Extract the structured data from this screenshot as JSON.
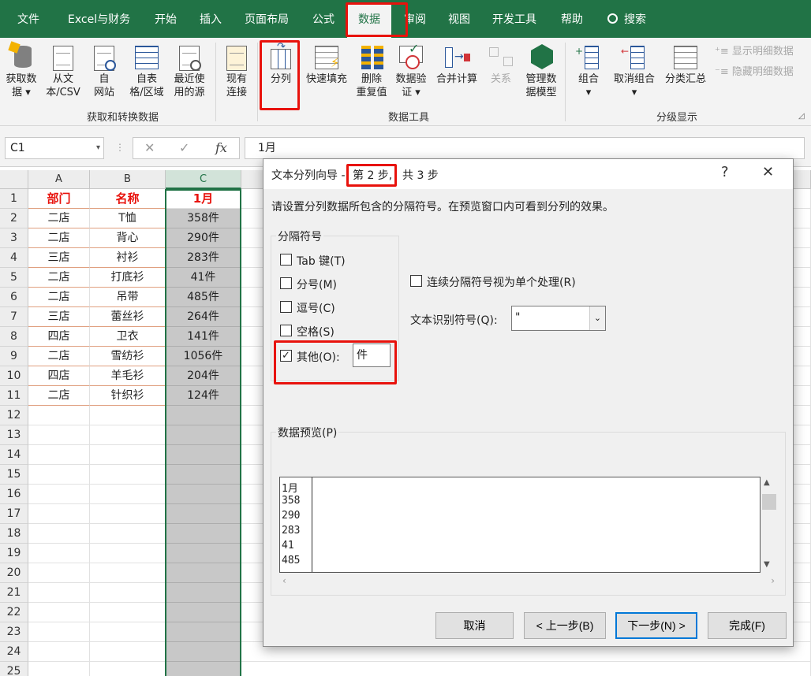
{
  "menu": [
    "文件",
    "Excel与财务",
    "开始",
    "插入",
    "页面布局",
    "公式",
    "数据",
    "审阅",
    "视图",
    "开发工具",
    "帮助"
  ],
  "search_label": "搜索",
  "ribbon": {
    "get_data": [
      "获取数",
      "据"
    ],
    "from_text": [
      "从文",
      "本/CSV"
    ],
    "from_web": [
      "自",
      "网站"
    ],
    "from_table": [
      "自表",
      "格/区域"
    ],
    "recent": [
      "最近使",
      "用的源"
    ],
    "existing": [
      "现有",
      "连接"
    ],
    "split": "分列",
    "flash_fill": "快速填充",
    "remove_dup": [
      "删除",
      "重复值"
    ],
    "validate": [
      "数据验",
      "证"
    ],
    "consolidate": "合并计算",
    "relations": "关系",
    "data_model": [
      "管理数",
      "据模型"
    ],
    "group": "组合",
    "ungroup": "取消组合",
    "subtotal": "分类汇总",
    "show_detail": "显示明细数据",
    "hide_detail": "隐藏明细数据",
    "group_get": "获取和转换数据",
    "group_tools": "数据工具",
    "group_outline": "分级显示"
  },
  "formula": {
    "name_box": "C1",
    "content": "1月"
  },
  "columns": [
    "A",
    "B",
    "C"
  ],
  "rows": [
    [
      "部门",
      "名称",
      "1月"
    ],
    [
      "二店",
      "T恤",
      "358件"
    ],
    [
      "二店",
      "背心",
      "290件"
    ],
    [
      "三店",
      "衬衫",
      "283件"
    ],
    [
      "二店",
      "打底衫",
      "41件"
    ],
    [
      "二店",
      "吊带",
      "485件"
    ],
    [
      "三店",
      "蕾丝衫",
      "264件"
    ],
    [
      "四店",
      "卫衣",
      "141件"
    ],
    [
      "二店",
      "雪纺衫",
      "1056件"
    ],
    [
      "四店",
      "羊毛衫",
      "204件"
    ],
    [
      "二店",
      "针织衫",
      "124件"
    ]
  ],
  "row_numbers": [
    "1",
    "2",
    "3",
    "4",
    "5",
    "6",
    "7",
    "8",
    "9",
    "10",
    "11",
    "12",
    "13",
    "14",
    "15",
    "16",
    "17",
    "18",
    "19",
    "20",
    "21",
    "22",
    "23",
    "24",
    "25"
  ],
  "dialog": {
    "title_prefix": "文本分列向导 - ",
    "title_step": "第 2 步,",
    "title_total": "共 3 步",
    "help": "?",
    "close": "✕",
    "instruction": "请设置分列数据所包含的分隔符号。在预览窗口内可看到分列的效果。",
    "delim_group": "分隔符号",
    "tab": "Tab 键(T)",
    "semicolon": "分号(M)",
    "comma": "逗号(C)",
    "space": "空格(S)",
    "other": "其他(O):",
    "other_value": "件",
    "consecutive": "连续分隔符号视为单个处理(R)",
    "qualifier_label": "文本识别符号(Q):",
    "qualifier_value": "\"",
    "preview_label": "数据预览(P)",
    "preview": [
      "1月",
      "358",
      "290",
      "283",
      "41",
      "485"
    ],
    "cancel": "取消",
    "back": "< 上一步(B)",
    "next": "下一步(N) >",
    "finish": "完成(F)"
  }
}
